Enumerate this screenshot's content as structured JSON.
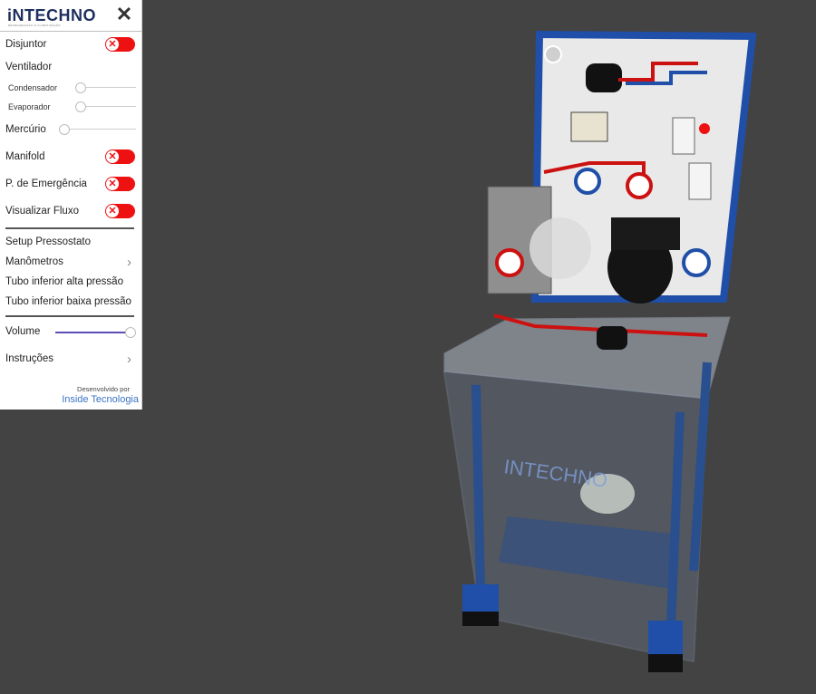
{
  "header": {
    "logo": "iNTECHNO",
    "logo_sub": "REFRIGERAÇÃO E CLIMATIZAÇÃO",
    "close_icon": "close-icon"
  },
  "menu": {
    "disjuntor": {
      "label": "Disjuntor",
      "on": false
    },
    "ventilador": {
      "label": "Ventilador"
    },
    "condensador": {
      "label": "Condensador",
      "level": 0
    },
    "evaporador": {
      "label": "Evaporador",
      "level": 0
    },
    "mercurio": {
      "label": "Mercúrio",
      "level": 0
    },
    "manifold": {
      "label": "Manifold",
      "on": false
    },
    "emergencia": {
      "label": "P. de Emergência",
      "on": false
    },
    "fluxo": {
      "label": "Visualizar Fluxo",
      "on": false
    },
    "setup": {
      "label": "Setup Pressostato"
    },
    "manometros": {
      "label": "Manômetros"
    },
    "tubo_alta": {
      "label": "Tubo inferior alta pressão"
    },
    "tubo_baixa": {
      "label": "Tubo inferior baixa pressão"
    },
    "volume": {
      "label": "Volume",
      "level": 1.0
    },
    "instrucoes": {
      "label": "Instruções"
    }
  },
  "credits": {
    "line1": "Desenvolvido por",
    "line2": "Inside Tecnologia"
  },
  "scene": {
    "brand_text": "INTECHNO"
  },
  "colors": {
    "toggle_off": "#ee1111",
    "accent": "#5b4fb5",
    "link": "#3b74c4",
    "panel_blue": "#1f4fa8",
    "background": "#434343"
  }
}
